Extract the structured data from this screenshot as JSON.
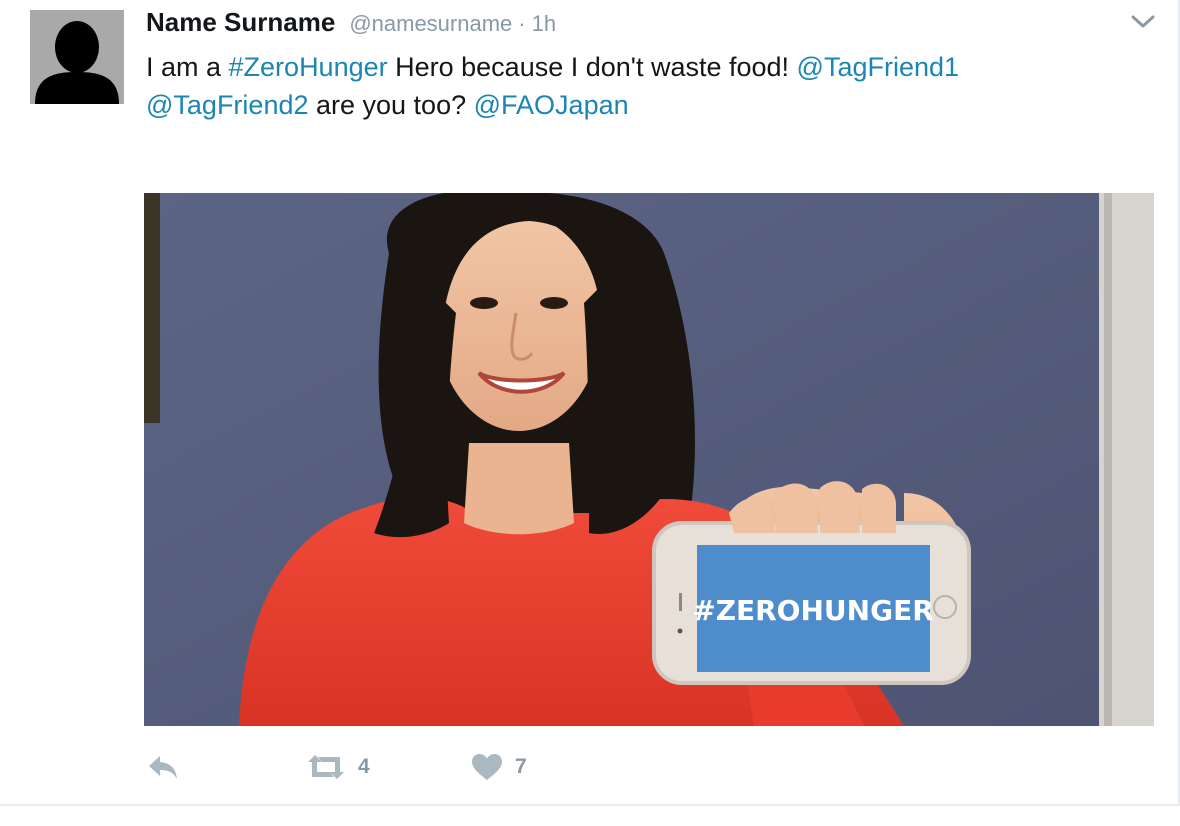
{
  "tweet": {
    "author_name": "Name Surname",
    "author_handle": "@namesurname",
    "separator": "·",
    "timestamp": "1h",
    "text_parts": [
      {
        "text": "I am a ",
        "kind": "plain"
      },
      {
        "text": "#ZeroHunger",
        "kind": "hashtag"
      },
      {
        "text": " Hero because I don't waste food! ",
        "kind": "plain"
      },
      {
        "text": "@TagFriend1",
        "kind": "mention"
      },
      {
        "text": "@TagFriend2",
        "kind": "mention"
      },
      {
        "text": " are you too? ",
        "kind": "plain"
      },
      {
        "text": "@FAOJapan",
        "kind": "mention"
      }
    ],
    "media": {
      "phone_screen_text": "#ZEROHUNGER"
    },
    "actions": {
      "reply_icon": "reply-icon",
      "retweet_icon": "retweet-icon",
      "retweet_count": "4",
      "like_icon": "heart-icon",
      "like_count": "7"
    },
    "menu_icon": "chevron-down-icon"
  },
  "colors": {
    "link": "#1b86b4",
    "muted": "#8899a6",
    "action_icon": "#aab8c2",
    "phone_screen": "#4f8ccb"
  }
}
